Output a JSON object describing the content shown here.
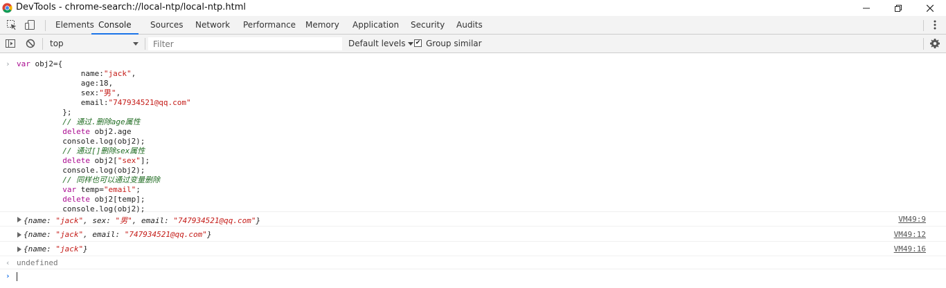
{
  "window": {
    "title": "DevTools - chrome-search://local-ntp/local-ntp.html",
    "controls": [
      "minimize-icon",
      "maximize-icon",
      "close-icon"
    ]
  },
  "tabbar": {
    "icons": [
      "inspect-element-icon",
      "device-toolbar-icon"
    ],
    "tabs": [
      {
        "label": "Elements",
        "active": false
      },
      {
        "label": "Console",
        "active": true
      },
      {
        "label": "Sources",
        "active": false
      },
      {
        "label": "Network",
        "active": false
      },
      {
        "label": "Performance",
        "active": false
      },
      {
        "label": "Memory",
        "active": false
      },
      {
        "label": "Application",
        "active": false
      },
      {
        "label": "Security",
        "active": false
      },
      {
        "label": "Audits",
        "active": false
      }
    ],
    "accent_color": "#1a73e8"
  },
  "console_toolbar": {
    "context": "top",
    "filter_placeholder": "Filter",
    "levels_label": "Default levels",
    "group_similar_label": "Group similar",
    "group_similar_checked": true
  },
  "input": {
    "lines": [
      [
        {
          "t": "kw",
          "v": "var"
        },
        {
          "t": "",
          "v": " obj2={"
        }
      ],
      [
        {
          "t": "",
          "v": "              name:"
        },
        {
          "t": "str",
          "v": "\"jack\""
        },
        {
          "t": "",
          "v": ","
        }
      ],
      [
        {
          "t": "",
          "v": "              age:18,"
        }
      ],
      [
        {
          "t": "",
          "v": "              sex:"
        },
        {
          "t": "str",
          "v": "\"男\""
        },
        {
          "t": "",
          "v": ","
        }
      ],
      [
        {
          "t": "",
          "v": "              email:"
        },
        {
          "t": "str",
          "v": "\"747934521@qq.com\""
        }
      ],
      [
        {
          "t": "",
          "v": "          };"
        }
      ],
      [
        {
          "t": "cmt",
          "v": "          // 通过.删除age属性"
        }
      ],
      [
        {
          "t": "kw",
          "v": "          delete"
        },
        {
          "t": "",
          "v": " obj2.age"
        }
      ],
      [
        {
          "t": "",
          "v": "          console.log(obj2);"
        }
      ],
      [
        {
          "t": "cmt",
          "v": "          // 通过[]删除sex属性"
        }
      ],
      [
        {
          "t": "kw",
          "v": "          delete"
        },
        {
          "t": "",
          "v": " obj2["
        },
        {
          "t": "str",
          "v": "\"sex\""
        },
        {
          "t": "",
          "v": "];"
        }
      ],
      [
        {
          "t": "",
          "v": "          console.log(obj2);"
        }
      ],
      [
        {
          "t": "cmt",
          "v": "          // 同样也可以通过变量删除"
        }
      ],
      [
        {
          "t": "kw",
          "v": "          var"
        },
        {
          "t": "",
          "v": " temp="
        },
        {
          "t": "str",
          "v": "\"email\""
        },
        {
          "t": "",
          "v": ";"
        }
      ],
      [
        {
          "t": "kw",
          "v": "          delete"
        },
        {
          "t": "",
          "v": " obj2[temp];"
        }
      ],
      [
        {
          "t": "",
          "v": "          console.log(obj2);"
        }
      ]
    ]
  },
  "logs": [
    {
      "parts": [
        {
          "t": "key",
          "v": "{name: "
        },
        {
          "t": "sv",
          "v": "\"jack\""
        },
        {
          "t": "key",
          "v": ", sex: "
        },
        {
          "t": "sv",
          "v": "\"男\""
        },
        {
          "t": "key",
          "v": ", email: "
        },
        {
          "t": "sv",
          "v": "\"747934521@qq.com\""
        },
        {
          "t": "key",
          "v": "}"
        }
      ],
      "source": "VM49:9"
    },
    {
      "parts": [
        {
          "t": "key",
          "v": "{name: "
        },
        {
          "t": "sv",
          "v": "\"jack\""
        },
        {
          "t": "key",
          "v": ", email: "
        },
        {
          "t": "sv",
          "v": "\"747934521@qq.com\""
        },
        {
          "t": "key",
          "v": "}"
        }
      ],
      "source": "VM49:12"
    },
    {
      "parts": [
        {
          "t": "key",
          "v": "{name: "
        },
        {
          "t": "sv",
          "v": "\"jack\""
        },
        {
          "t": "key",
          "v": "}"
        }
      ],
      "source": "VM49:16"
    }
  ],
  "result": "undefined"
}
